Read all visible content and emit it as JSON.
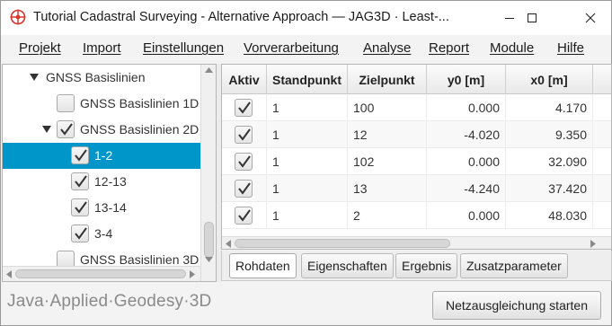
{
  "window": {
    "title": "Tutorial Cadastral Surveying - Alternative Approach — JAG3D · Least-..."
  },
  "menu": [
    "Projekt",
    "Import",
    "Einstellungen",
    "Vorverarbeitung",
    "Analyse",
    "Report",
    "Module",
    "Hilfe"
  ],
  "tree": {
    "root": "GNSS Basislinien",
    "items": [
      {
        "label": "GNSS Basislinien 1D",
        "checked": false
      },
      {
        "label": "GNSS Basislinien 2D",
        "checked": true
      },
      {
        "label": "1-2",
        "checked": true,
        "selected": true
      },
      {
        "label": "12-13",
        "checked": true
      },
      {
        "label": "13-14",
        "checked": true
      },
      {
        "label": "3-4",
        "checked": true
      },
      {
        "label": "GNSS Basislinien 3D",
        "checked": false
      }
    ]
  },
  "table": {
    "columns": [
      "Aktiv",
      "Standpunkt",
      "Zielpunkt",
      "y0 [m]",
      "x0 [m]"
    ],
    "rows": [
      {
        "aktiv": true,
        "standpunkt": "1",
        "zielpunkt": "100",
        "y0": "0.000",
        "x0": "4.170"
      },
      {
        "aktiv": true,
        "standpunkt": "1",
        "zielpunkt": "12",
        "y0": "-4.020",
        "x0": "9.350"
      },
      {
        "aktiv": true,
        "standpunkt": "1",
        "zielpunkt": "102",
        "y0": "0.000",
        "x0": "32.090"
      },
      {
        "aktiv": true,
        "standpunkt": "1",
        "zielpunkt": "13",
        "y0": "-4.240",
        "x0": "37.420"
      },
      {
        "aktiv": true,
        "standpunkt": "1",
        "zielpunkt": "2",
        "y0": "0.000",
        "x0": "48.030"
      }
    ]
  },
  "tabs": [
    "Rohdaten",
    "Eigenschaften",
    "Ergebnis",
    "Zusatzparameter"
  ],
  "footer": {
    "brand": "Java·Applied·Geodesy·3D",
    "start_button": "Netzausgleichung starten"
  },
  "colors": {
    "selection": "#0096c9",
    "logo_red": "#d9342b"
  }
}
